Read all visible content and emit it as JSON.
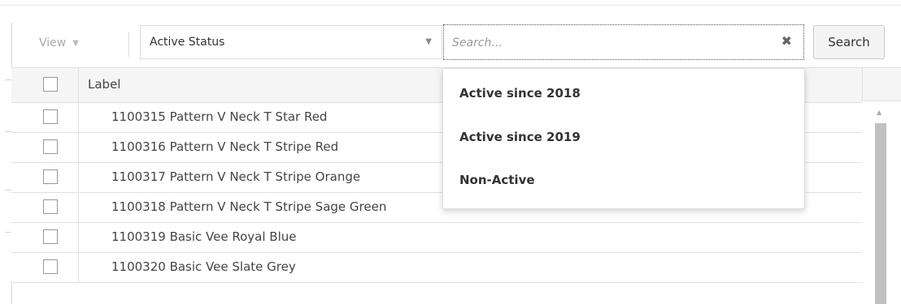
{
  "toolbar": {
    "view_label": "View",
    "status_select_value": "Active Status",
    "search_placeholder": "Search...",
    "search_button_label": "Search"
  },
  "table": {
    "header_label": "Label",
    "rows": [
      {
        "label": "1100315 Pattern V Neck T Star Red",
        "checked": false
      },
      {
        "label": "1100316 Pattern V Neck T Stripe Red",
        "checked": false
      },
      {
        "label": "1100317 Pattern V Neck T Stripe Orange",
        "checked": false
      },
      {
        "label": "1100318 Pattern V Neck T Stripe Sage Green",
        "checked": false
      },
      {
        "label": "1100319 Basic Vee Royal Blue",
        "checked": false
      },
      {
        "label": "1100320 Basic Vee Slate Grey",
        "checked": false
      }
    ]
  },
  "dropdown": {
    "options": [
      "Active since 2018",
      "Active since 2019",
      "Non-Active"
    ]
  },
  "icons": {
    "view_caret": "caret-down-icon",
    "select_caret": "caret-down-icon",
    "clear": "clear-x-icon",
    "scroll_up": "scroll-up-arrow-icon"
  }
}
